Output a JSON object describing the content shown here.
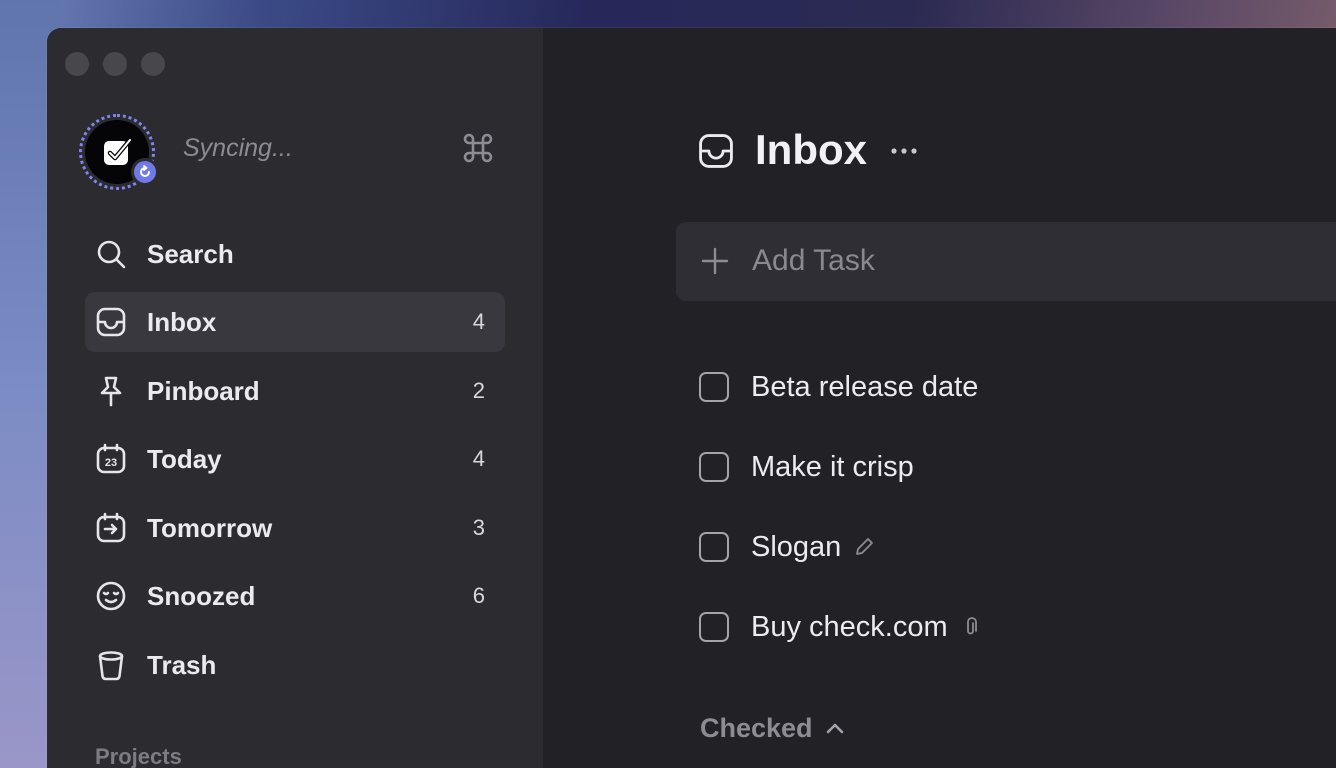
{
  "window": {
    "sync_status": "Syncing...",
    "shortcut_icon": "command-key-icon"
  },
  "sidebar": {
    "items": [
      {
        "label": "Search",
        "count": "",
        "icon": "search-icon",
        "active": false
      },
      {
        "label": "Inbox",
        "count": "4",
        "icon": "inbox-icon",
        "active": true
      },
      {
        "label": "Pinboard",
        "count": "2",
        "icon": "pin-icon",
        "active": false
      },
      {
        "label": "Today",
        "count": "4",
        "icon": "calendar-23-icon",
        "active": false
      },
      {
        "label": "Tomorrow",
        "count": "3",
        "icon": "calendar-arrow-icon",
        "active": false
      },
      {
        "label": "Snoozed",
        "count": "6",
        "icon": "sleeping-face-icon",
        "active": false
      },
      {
        "label": "Trash",
        "count": "",
        "icon": "trash-icon",
        "active": false
      }
    ],
    "projects_label": "Projects",
    "calendar_icon_text": "23"
  },
  "main": {
    "title": "Inbox",
    "add_task_label": "Add Task",
    "tasks": [
      {
        "label": "Beta release date",
        "meta_icon": ""
      },
      {
        "label": "Make it crisp",
        "meta_icon": ""
      },
      {
        "label": "Slogan",
        "meta_icon": "pencil-icon"
      },
      {
        "label": "Buy check.com",
        "meta_icon": "paperclip-icon"
      }
    ],
    "checked_label": "Checked"
  },
  "colors": {
    "accent": "#6f7ae8",
    "sidebar_bg": "#2c2b30",
    "main_bg": "#222126",
    "active_item_bg": "#39383e"
  }
}
